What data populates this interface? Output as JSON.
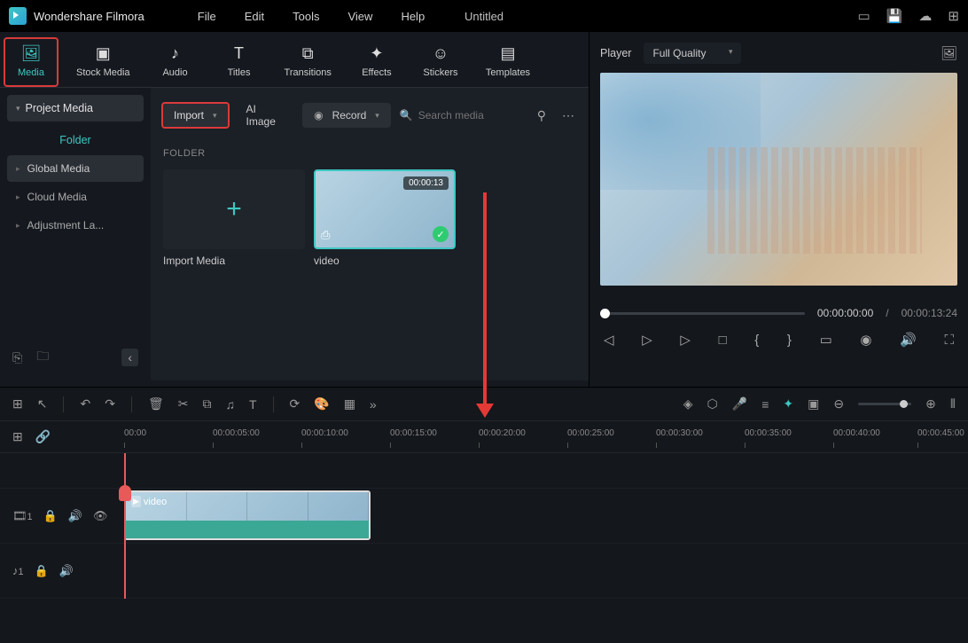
{
  "app_name": "Wondershare Filmora",
  "menu": [
    "File",
    "Edit",
    "Tools",
    "View",
    "Help"
  ],
  "doc_title": "Untitled",
  "tabs": [
    {
      "label": "Media",
      "active": true
    },
    {
      "label": "Stock Media"
    },
    {
      "label": "Audio"
    },
    {
      "label": "Titles"
    },
    {
      "label": "Transitions"
    },
    {
      "label": "Effects"
    },
    {
      "label": "Stickers"
    },
    {
      "label": "Templates"
    }
  ],
  "sidebar": {
    "title": "Project Media",
    "folder_label": "Folder",
    "items": [
      "Global Media",
      "Cloud Media",
      "Adjustment La..."
    ]
  },
  "media_toolbar": {
    "import": "Import",
    "ai_image": "AI Image",
    "record": "Record",
    "search_placeholder": "Search media"
  },
  "folder_header": "FOLDER",
  "media_items": {
    "import_label": "Import Media",
    "video": {
      "label": "video",
      "duration": "00:00:13"
    }
  },
  "preview": {
    "player": "Player",
    "quality": "Full Quality",
    "current": "00:00:00:00",
    "total": "00:00:13:24"
  },
  "timeline": {
    "ticks": [
      "00:00",
      "00:00:05:00",
      "00:00:10:00",
      "00:00:15:00",
      "00:00:20:00",
      "00:00:25:00",
      "00:00:30:00",
      "00:00:35:00",
      "00:00:40:00",
      "00:00:45:00"
    ],
    "video_track": "1",
    "audio_track": "1",
    "clip_label": "video"
  }
}
